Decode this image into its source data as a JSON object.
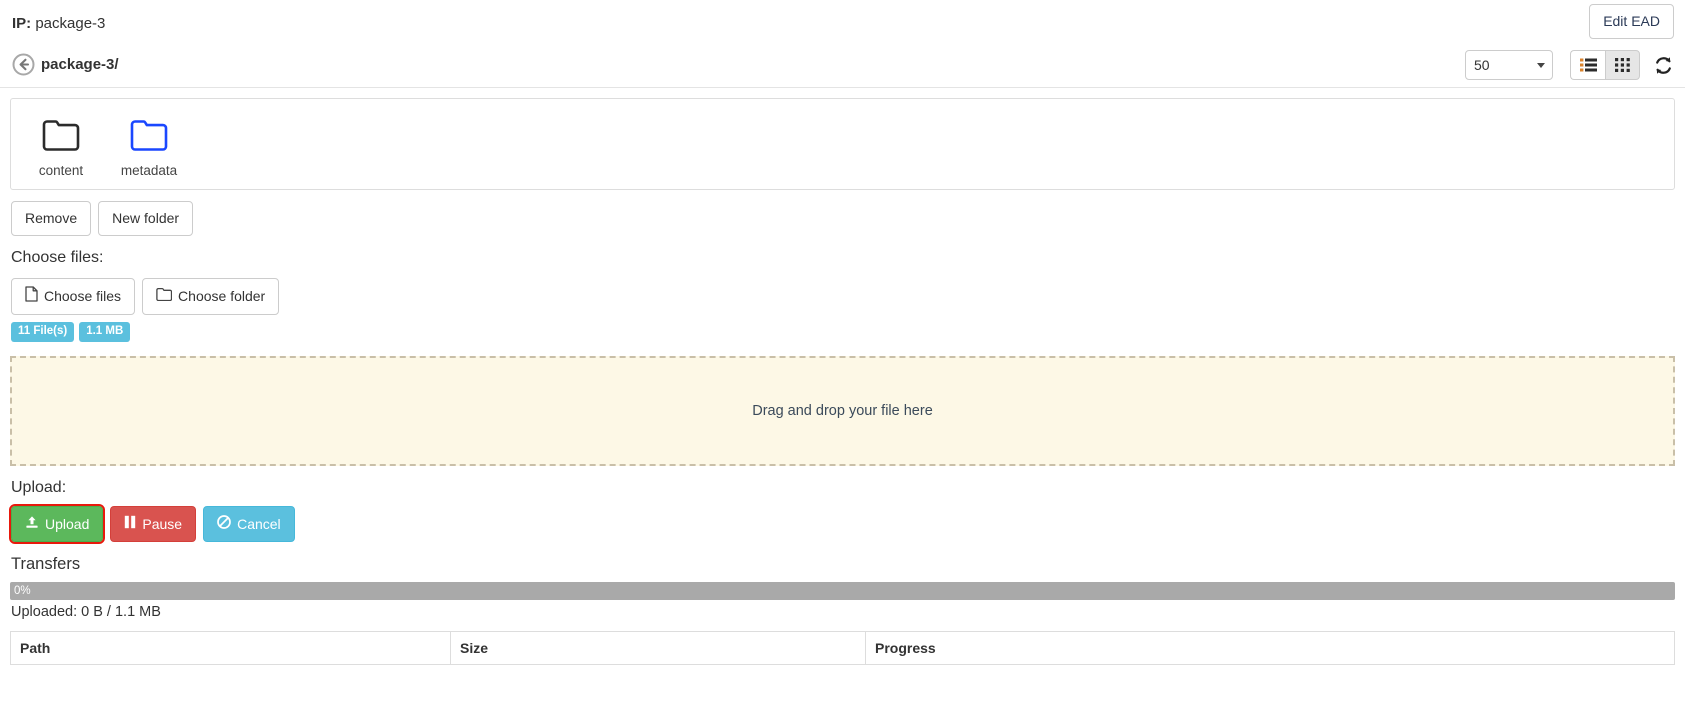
{
  "header": {
    "ip_label": "IP:",
    "ip_value": "package-3",
    "edit_ead_label": "Edit EAD"
  },
  "breadcrumb": {
    "back_icon": "circle-arrow-left-icon",
    "path": "package-3/"
  },
  "toolbar": {
    "page_size": "50",
    "page_size_options": [
      "50"
    ],
    "list_view_icon": "list-view-icon",
    "grid_view_icon": "grid-view-icon",
    "active_view": "grid",
    "refresh_icon": "refresh-icon"
  },
  "browser": {
    "items": [
      {
        "name": "content",
        "icon": "folder-icon",
        "color": "#2b2b2b",
        "selected": false
      },
      {
        "name": "metadata",
        "icon": "folder-icon",
        "color": "#1a47ff",
        "selected": true
      }
    ]
  },
  "actions": {
    "remove_label": "Remove",
    "new_folder_label": "New folder"
  },
  "choose": {
    "section_label": "Choose files:",
    "choose_files_label": "Choose files",
    "choose_files_icon": "file-icon",
    "choose_folder_label": "Choose folder",
    "choose_folder_icon": "folder-open-icon",
    "badges": [
      {
        "text": "11 File(s)",
        "color": "#5bc0de"
      },
      {
        "text": "1.1 MB",
        "color": "#5bc0de"
      }
    ]
  },
  "dropzone": {
    "text": "Drag and drop your file here"
  },
  "upload": {
    "section_label": "Upload:",
    "buttons": [
      {
        "label": "Upload",
        "icon": "upload-icon",
        "style": "green",
        "focused": true
      },
      {
        "label": "Pause",
        "icon": "pause-icon",
        "style": "red",
        "focused": false
      },
      {
        "label": "Cancel",
        "icon": "ban-icon",
        "style": "blue",
        "focused": false
      }
    ]
  },
  "transfers": {
    "heading": "Transfers",
    "progress_percent": "0%",
    "progress_value": 0,
    "uploaded_line": "Uploaded: 0 B / 1.1 MB",
    "columns": [
      "Path",
      "Size",
      "Progress"
    ],
    "rows": []
  }
}
